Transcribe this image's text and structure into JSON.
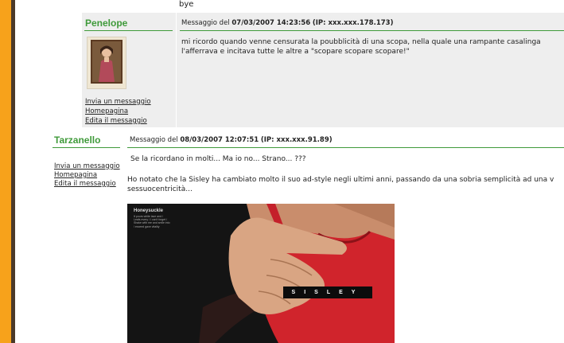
{
  "top_text": "bye",
  "post1": {
    "author": "Penelope",
    "header_prefix": "Messaggio del",
    "header_date": "07/03/2007 14:23:56",
    "header_ip": "(IP: xxx.xxx.178.173)",
    "body": "mi ricordo quando venne censurata la poubblicità di una scopa, nella quale una rampante casalinga l'afferrava e incitava tutte le altre a \"scopare scopare scopare!\"",
    "links": [
      "Invia un messaggio",
      "Homepagina",
      "Edita il messaggio"
    ]
  },
  "post2": {
    "author": "Tarzanello",
    "header_prefix": "Messaggio del",
    "header_date": "08/03/2007 12:07:51",
    "header_ip": "(IP: xxx.xxx.91.89)",
    "line1": "Se la ricordano in molti... Ma io no... Strano... ???",
    "line2": "Ho notato che la Sisley ha cambiato molto il suo ad-style negli ultimi anni, passando da una sobria semplicità ad una v",
    "line3": "sessuocentricità...",
    "links": [
      "Invia un messaggio",
      "Homepagina",
      "Edita il messaggio"
    ],
    "image": {
      "title": "Honeysuckle",
      "copy": "It pours white lace and / Leafs every / I can't forget / Shake with me and smile into / exceed gave vitality",
      "logo": "SISLEY"
    }
  },
  "colors": {
    "accent": "#3f9a3a",
    "sidebar_orange": "#f7a21b",
    "post_background": "#eeeeee"
  }
}
